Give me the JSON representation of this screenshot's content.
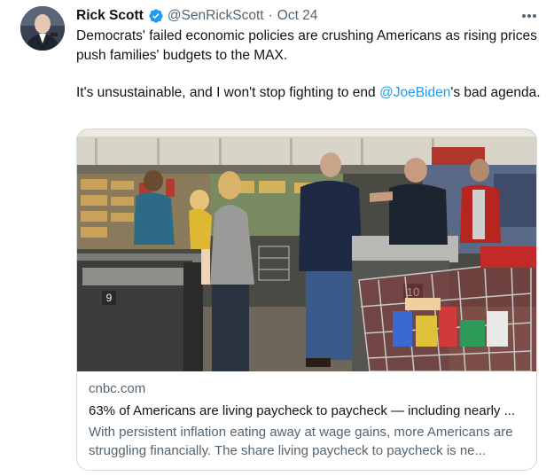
{
  "author": {
    "name": "Rick Scott",
    "handle": "@SenRickScott",
    "separator": "·",
    "date": "Oct 24"
  },
  "tweet": {
    "paragraph1": "Democrats' failed economic policies are crushing Americans as rising prices push families' budgets to the MAX.",
    "paragraph2_before": "It's unsustainable, and I won't stop fighting to end ",
    "paragraph2_mention": "@JoeBiden",
    "paragraph2_after": "'s bad agenda."
  },
  "card": {
    "domain": "cnbc.com",
    "title": "63% of Americans are living paycheck to paycheck — including nearly ...",
    "description": "With persistent inflation eating away at wage gains, more Americans are struggling financially. The share living paycheck to paycheck is ne...",
    "register_numbers": [
      "9",
      "10"
    ]
  },
  "icons": {
    "verified": "verified-badge-icon",
    "more": "more-options-icon"
  },
  "colors": {
    "text": "#0f1419",
    "secondary": "#536471",
    "link": "#1d9bf0",
    "border": "#cfd9de"
  }
}
